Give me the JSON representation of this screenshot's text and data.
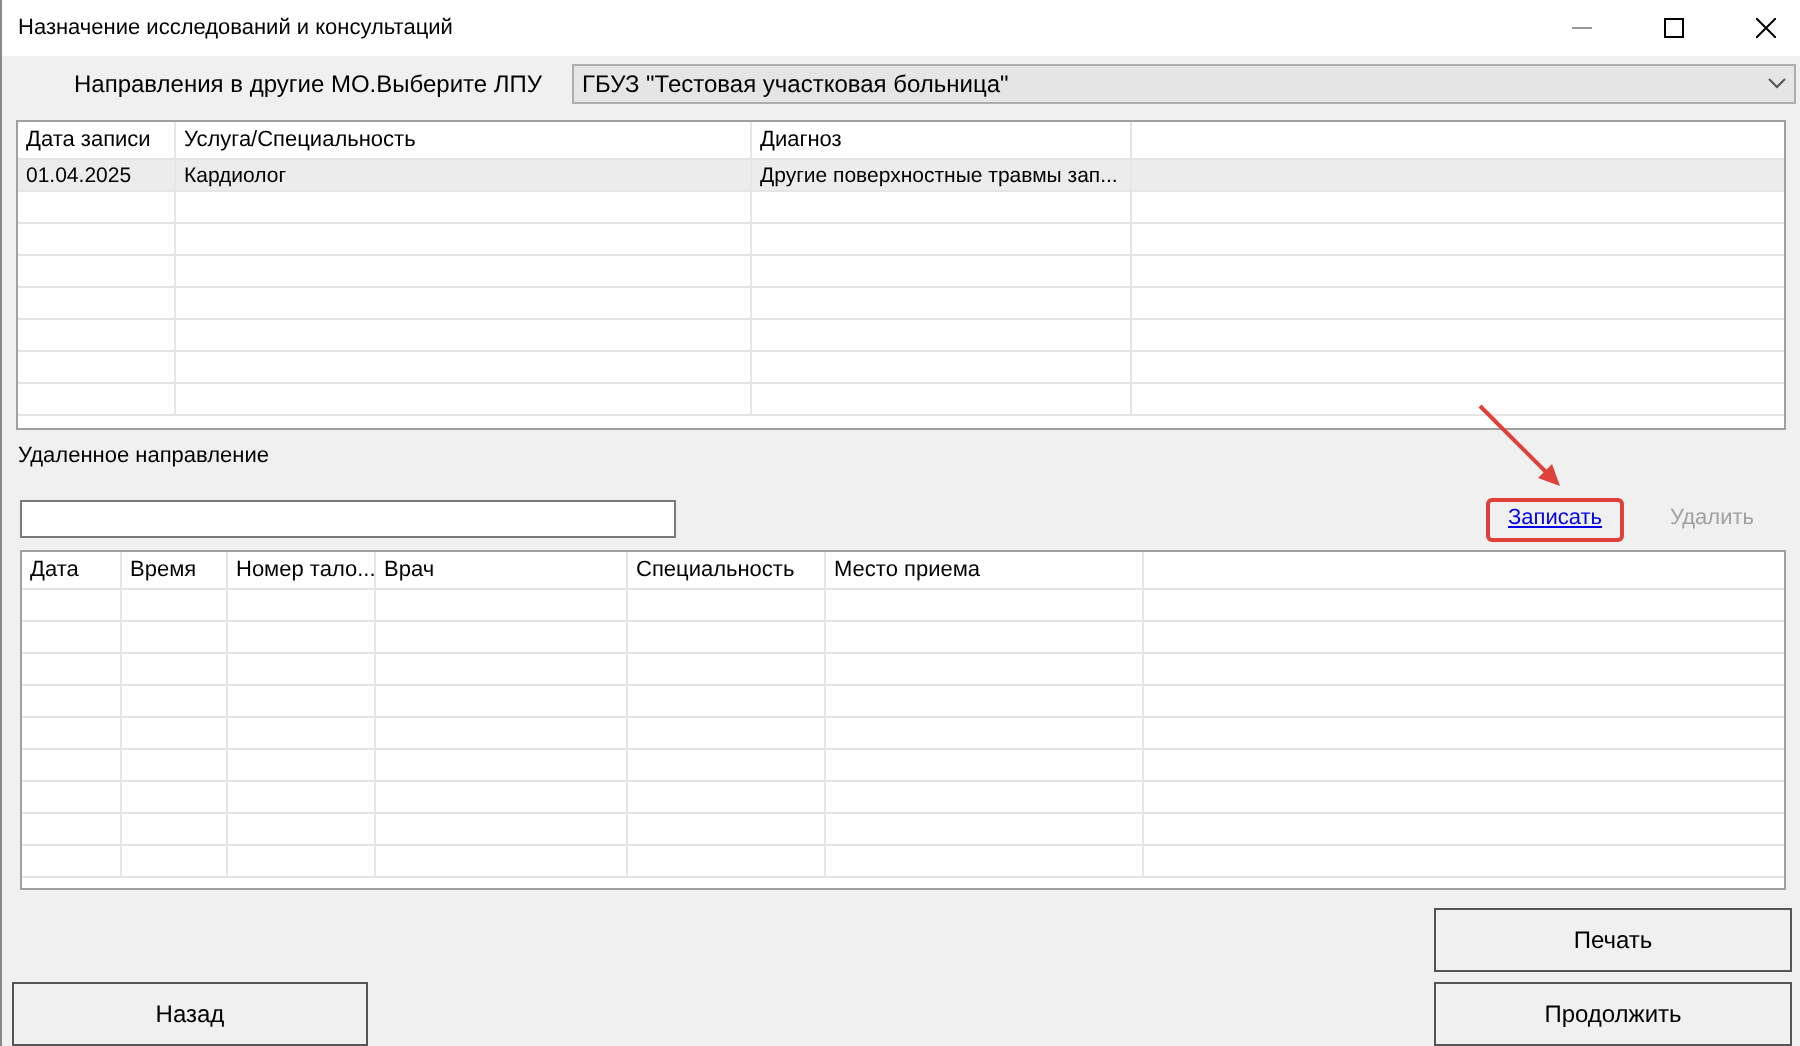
{
  "window": {
    "title": "Назначение исследований и консультаций"
  },
  "clinic_select": {
    "label": "Направления в другие МО.Выберите ЛПУ",
    "value": "ГБУЗ \"Тестовая участковая больница\""
  },
  "referrals_table": {
    "columns": [
      "Дата записи",
      "Услуга/Специальность",
      "Диагноз"
    ],
    "rows": [
      {
        "selected": true,
        "cells": [
          "01.04.2025",
          "Кардиолог",
          "Другие поверхностные травмы зап..."
        ]
      }
    ]
  },
  "remote_referral": {
    "label": "Удаленное направление"
  },
  "actions": [
    {
      "label": "Записать",
      "disabled": false,
      "highlighted": true
    },
    {
      "label": "Удалить",
      "disabled": true,
      "highlighted": false
    }
  ],
  "appointments_table": {
    "columns": [
      "Дата",
      "Время",
      "Номер тало...",
      "Врач",
      "Специальность",
      "Место приема"
    ]
  },
  "buttons": {
    "print": "Печать",
    "back": "Назад",
    "continue": "Продолжить"
  }
}
